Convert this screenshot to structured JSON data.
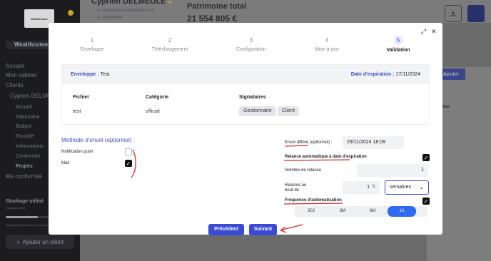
{
  "app": {
    "logo_text": "Wealthcome",
    "brand": "Wealthcome",
    "nav": {
      "accueil": "Accueil",
      "mon_cabinet": "Mon cabinet",
      "clients": "Clients",
      "client_current": "Cyprien DELMEULE",
      "sub_accueil": "Accueil",
      "sub_patrimoine": "Patrimoine",
      "sub_budget": "Budget",
      "sub_fiscalite": "Fiscalité",
      "sub_informations": "Informations",
      "sub_conformite": "Conformité",
      "sub_projets": "Projets",
      "ma_conformite": "Ma conformité"
    },
    "storage": {
      "title": "Stockage utilisé",
      "used_text": "Stockage utilisé",
      "used_fraction": 0.72,
      "detail": "Stockage utilisé dans votre espace"
    },
    "add_client_label": "Ajouter un client",
    "client": {
      "name": "Cyprien DELMEULE",
      "email": "cyprien.delmeule@wealthcome.fr",
      "phone": "0658050809"
    },
    "wealth": {
      "label": "Patrimoine total",
      "value": "21 554 805 €"
    },
    "bg_add_label": "Ajouter",
    "bg_action_header": "Action"
  },
  "modal": {
    "steps": [
      {
        "num": "1",
        "label": "Enveloppe"
      },
      {
        "num": "2",
        "label": "Téléchargement"
      },
      {
        "num": "3",
        "label": "Configuration"
      },
      {
        "num": "4",
        "label": "Mise à jour"
      },
      {
        "num": "5",
        "label": "Validation"
      }
    ],
    "summary": {
      "envelope_label": "Enveloppe",
      "envelope_value": "Test",
      "expiration_label": "Date d'expiration",
      "expiration_value": "17/11/2024",
      "col_file": "Fichier",
      "col_category": "Catégorie",
      "col_signers": "Signataires",
      "file": "test",
      "category": "official",
      "signers": [
        "Gestionnaire",
        "Client"
      ]
    },
    "send_method": {
      "title": "Méthode d'envoi (optionnel) :",
      "push_label": "Notification push",
      "push_checked": false,
      "mail_label": "Mail",
      "mail_checked": true
    },
    "options": {
      "deferred_label": "Envoi différé (optionnel) :",
      "deferred_value": "29/11/2024 18:09",
      "auto_reminder_label": "Relance automatique à date d'expiration",
      "auto_reminder_checked": true,
      "reminder_count_label": "Nombre de relance",
      "reminder_count_value": "1",
      "reminder_every_label": "Relance au bout de",
      "reminder_every_value": "1",
      "reminder_unit": "semaines",
      "automation_freq_label": "Fréquence d'automatisation",
      "automation_freq_checked": true,
      "freq_options": [
        "30J",
        "3M",
        "6M",
        "1A"
      ],
      "freq_selected": "1A"
    },
    "buttons": {
      "previous": "Précédent",
      "next": "Suivant"
    }
  },
  "colors": {
    "accent": "#3b4bd6",
    "selected_pill": "#2f6af5",
    "annotation": "#e0252b"
  }
}
